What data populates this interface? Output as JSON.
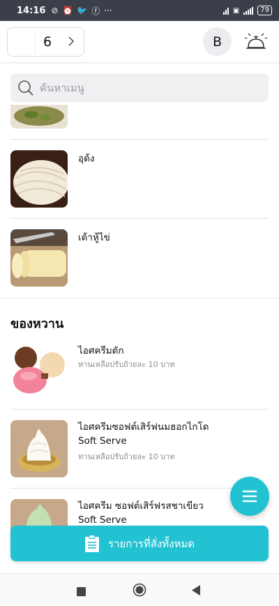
{
  "status_bar": {
    "time": "14:16",
    "battery": "79",
    "more": "···"
  },
  "header": {
    "table_number": "6",
    "avatar_letter": "B"
  },
  "search": {
    "placeholder": "ค้นหาเมนู"
  },
  "menu": {
    "items_top": [
      {
        "name": "อุด้ง"
      },
      {
        "name": "เต้าหู้ไข่"
      }
    ],
    "section_title": "ของหวาน",
    "items_dessert": [
      {
        "name": "ไอศครีมตัก",
        "name2": "",
        "note": "ทานเหลือปรับถ้วยละ 10 บาท"
      },
      {
        "name": "ไอศครีมซอฟต์เสิร์ฟนมฮอกไกโด",
        "name2": "Soft Serve",
        "note": "ทานเหลือปรับถ้วยละ 10 บาท"
      },
      {
        "name": "ไอศครีม ซอฟต์เสิร์ฟรสชาเขียว",
        "name2": "Soft Serve",
        "note": ""
      }
    ]
  },
  "actions": {
    "orders_label": "รายการที่สั่งทั้งหมด"
  },
  "colors": {
    "accent": "#22c2d3",
    "status_bar": "#3b3f4a"
  },
  "icons": [
    "search-icon",
    "chevron-right-icon",
    "service-bell-icon",
    "menu-list-icon",
    "clipboard-icon",
    "nav-square-icon",
    "nav-circle-icon",
    "nav-back-icon"
  ]
}
